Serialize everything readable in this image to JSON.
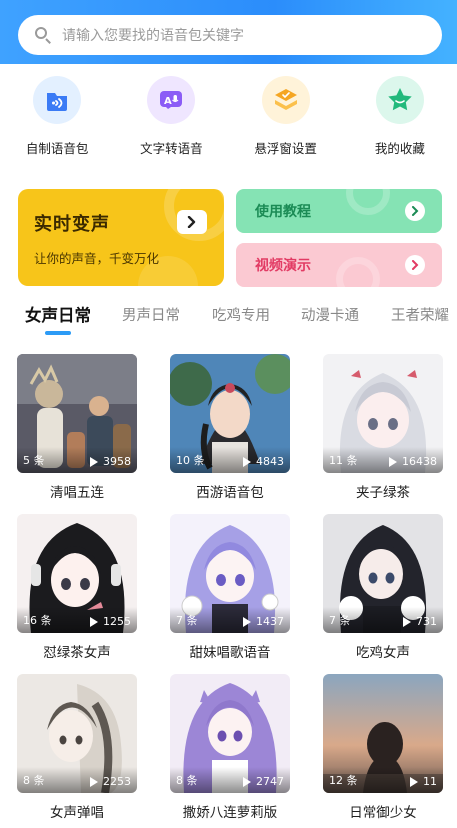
{
  "search": {
    "placeholder": "请输入您要找的语音包关键字"
  },
  "quick": [
    {
      "label": "自制语音包",
      "icon": "voice-pack-icon",
      "bg": "#e3f0ff",
      "color": "#3b7bf5"
    },
    {
      "label": "文字转语音",
      "icon": "text-to-speech-icon",
      "bg": "#efe6ff",
      "color": "#8b5cf6"
    },
    {
      "label": "悬浮窗设置",
      "icon": "floating-window-icon",
      "bg": "#fff3d9",
      "color": "#f5a623"
    },
    {
      "label": "我的收藏",
      "icon": "favorite-star-icon",
      "bg": "#dcf7ec",
      "color": "#22b97c"
    }
  ],
  "banner": {
    "title": "实时变声",
    "subtitle": "让你的声音，千变万化",
    "bg": "#f7c51a"
  },
  "side_banners": [
    {
      "title": "使用教程",
      "bg": "#85e3b4"
    },
    {
      "title": "视频演示",
      "bg": "#fbc9d2"
    }
  ],
  "tabs": [
    "女声日常",
    "男声日常",
    "吃鸡专用",
    "动漫卡通",
    "王者荣耀"
  ],
  "accent": "#2c9bf6",
  "cards": [
    {
      "title": "清唱五连",
      "count": "5 条",
      "plays": "3958"
    },
    {
      "title": "西游语音包",
      "count": "10 条",
      "plays": "4843"
    },
    {
      "title": "夹子绿茶",
      "count": "11 条",
      "plays": "16438"
    },
    {
      "title": "怼绿茶女声",
      "count": "16 条",
      "plays": "1255"
    },
    {
      "title": "甜妹唱歌语音",
      "count": "7 条",
      "plays": "1437"
    },
    {
      "title": "吃鸡女声",
      "count": "7 条",
      "plays": "731"
    },
    {
      "title": "女声弹唱",
      "count": "8 条",
      "plays": "2253"
    },
    {
      "title": "撒娇八连萝莉版",
      "count": "8 条",
      "plays": "2747"
    },
    {
      "title": "日常御少女",
      "count": "12 条",
      "plays": "11"
    }
  ]
}
